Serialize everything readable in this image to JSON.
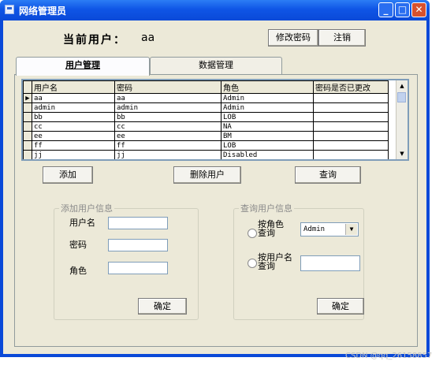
{
  "window": {
    "title": "网络管理员"
  },
  "header": {
    "current_user_label": "当前用户：",
    "current_user": "aa",
    "change_password": "修改密码",
    "logout": "注销"
  },
  "tabs": [
    {
      "label": "用户管理"
    },
    {
      "label": "数据管理"
    }
  ],
  "grid": {
    "columns": [
      "用户名",
      "密码",
      "角色",
      "密码是否已更改"
    ],
    "rows": [
      [
        "aa",
        "aa",
        "Admin",
        ""
      ],
      [
        "admin",
        "admin",
        "Admin",
        ""
      ],
      [
        "bb",
        "bb",
        "LOB",
        ""
      ],
      [
        "cc",
        "cc",
        "NA",
        ""
      ],
      [
        "ee",
        "ee",
        "BM",
        ""
      ],
      [
        "ff",
        "ff",
        "LOB",
        ""
      ],
      [
        "jj",
        "jj",
        "Disabled",
        ""
      ]
    ]
  },
  "actions": {
    "add": "添加",
    "delete_user": "删除用户",
    "query": "查询"
  },
  "add_user": {
    "legend": "添加用户信息",
    "username_label": "用户名",
    "password_label": "密码",
    "role_label": "角色",
    "confirm": "确定"
  },
  "query_user": {
    "legend": "查询用户信息",
    "by_role_label": [
      "按角色",
      "查询"
    ],
    "role_value": "Admin",
    "by_username_label": [
      "按用户名",
      "查询"
    ],
    "confirm": "确定"
  },
  "watermark": "CSDN @qq_26158857"
}
